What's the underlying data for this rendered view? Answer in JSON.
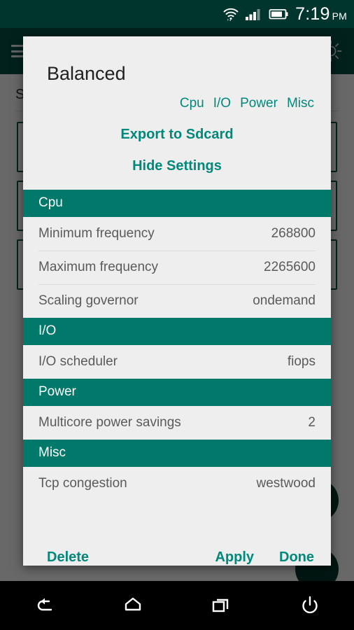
{
  "status_bar": {
    "wifi_icon": "wifi-icon",
    "signal_icon": "cellular-signal-icon",
    "battery_icon": "battery-icon",
    "time": "7:19",
    "ampm": "PM"
  },
  "background_app": {
    "menu_icon": "hamburger-menu-icon",
    "title": "",
    "brightness_icon": "sun-brightness-icon",
    "section_title": "Se",
    "fab_primary": "fab-primary",
    "fab_secondary": "fab-secondary"
  },
  "dialog": {
    "title": "Balanced",
    "nav_links": [
      "Cpu",
      "I/O",
      "Power",
      "Misc"
    ],
    "export_label": "Export to Sdcard",
    "hide_label": "Hide Settings",
    "sections": [
      {
        "name": "Cpu",
        "rows": [
          {
            "key": "Minimum frequency",
            "value": "268800"
          },
          {
            "key": "Maximum frequency",
            "value": "2265600"
          },
          {
            "key": "Scaling governor",
            "value": "ondemand"
          }
        ]
      },
      {
        "name": "I/O",
        "rows": [
          {
            "key": "I/O scheduler",
            "value": "fiops"
          }
        ]
      },
      {
        "name": "Power",
        "rows": [
          {
            "key": "Multicore power savings",
            "value": "2"
          }
        ]
      },
      {
        "name": "Misc",
        "rows": [
          {
            "key": "Tcp congestion",
            "value": "westwood"
          }
        ]
      }
    ],
    "actions": {
      "delete": "Delete",
      "apply": "Apply",
      "done": "Done"
    }
  },
  "nav_bar": {
    "back_icon": "back-arrow-icon",
    "home_icon": "home-icon",
    "recents_icon": "recent-apps-icon",
    "power_icon": "power-icon"
  },
  "colors": {
    "status_bar": "#00352e",
    "toolbar": "#064a40",
    "section_header": "#00796b",
    "accent_link": "#00897b",
    "dialog_bg": "#eeeeee",
    "row_text": "#5a5a5a"
  }
}
